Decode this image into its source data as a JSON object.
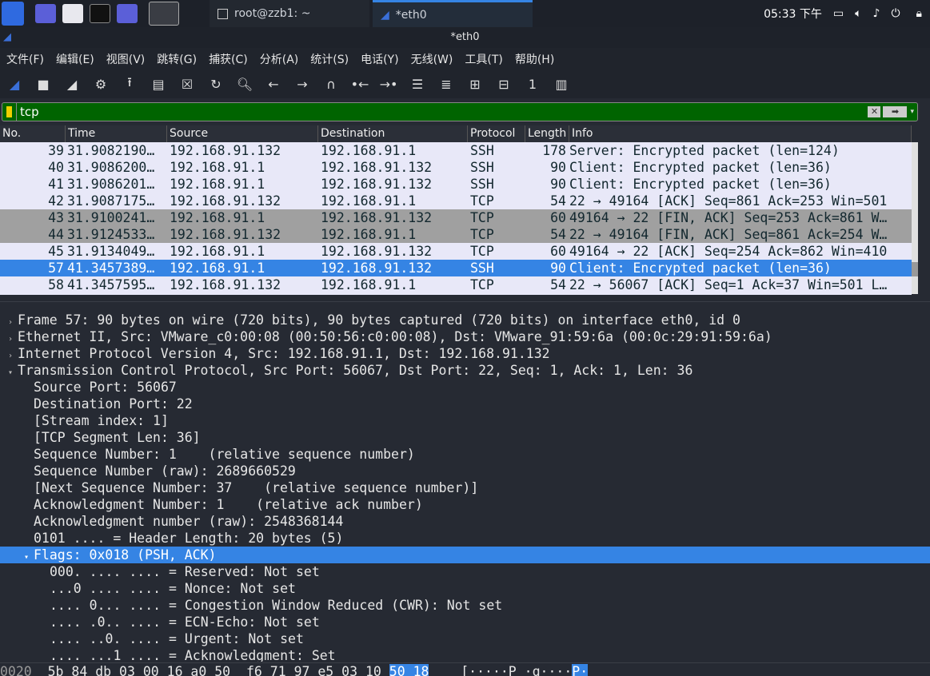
{
  "taskbar": {
    "tasks": [
      {
        "label": "root@zzb1: ~"
      },
      {
        "label": "*eth0"
      }
    ],
    "clock": "05:33 下午"
  },
  "window": {
    "title": "*eth0"
  },
  "menu": [
    "文件(F)",
    "编辑(E)",
    "视图(V)",
    "跳转(G)",
    "捕获(C)",
    "分析(A)",
    "统计(S)",
    "电话(Y)",
    "无线(W)",
    "工具(T)",
    "帮助(H)"
  ],
  "toolbar": [
    "start-capture-icon",
    "stop-capture-icon",
    "restart-capture-icon",
    "options-gear-icon",
    "open-file-icon",
    "save-file-icon",
    "close-file-icon",
    "reload-file-icon",
    "search-icon",
    "back-arrow-icon",
    "forward-arrow-icon",
    "goto-packet-icon",
    "first-packet-icon",
    "last-packet-icon",
    "autoscroll-icon",
    "colorize-icon",
    "zoom-in-icon",
    "zoom-out-icon",
    "normal-size-icon",
    "resize-columns-icon"
  ],
  "filter": {
    "value": "tcp"
  },
  "packet_list": {
    "columns": [
      "No.",
      "Time",
      "Source",
      "Destination",
      "Protocol",
      "Length",
      "Info"
    ],
    "rows": [
      {
        "no": "39",
        "time": "31.9082190…",
        "src": "192.168.91.132",
        "dst": "192.168.91.1",
        "proto": "SSH",
        "len": "178",
        "info": "Server: Encrypted packet (len=124)",
        "style": "normal"
      },
      {
        "no": "40",
        "time": "31.9086200…",
        "src": "192.168.91.1",
        "dst": "192.168.91.132",
        "proto": "SSH",
        "len": "90",
        "info": "Client: Encrypted packet (len=36)",
        "style": "normal"
      },
      {
        "no": "41",
        "time": "31.9086201…",
        "src": "192.168.91.1",
        "dst": "192.168.91.132",
        "proto": "SSH",
        "len": "90",
        "info": "Client: Encrypted packet (len=36)",
        "style": "normal"
      },
      {
        "no": "42",
        "time": "31.9087175…",
        "src": "192.168.91.132",
        "dst": "192.168.91.1",
        "proto": "TCP",
        "len": "54",
        "info": "22 → 49164 [ACK] Seq=861 Ack=253 Win=501",
        "style": "normal"
      },
      {
        "no": "43",
        "time": "31.9100241…",
        "src": "192.168.91.1",
        "dst": "192.168.91.132",
        "proto": "TCP",
        "len": "60",
        "info": "49164 → 22 [FIN, ACK] Seq=253 Ack=861 W…",
        "style": "fin"
      },
      {
        "no": "44",
        "time": "31.9124533…",
        "src": "192.168.91.132",
        "dst": "192.168.91.1",
        "proto": "TCP",
        "len": "54",
        "info": "22 → 49164 [FIN, ACK] Seq=861 Ack=254 W…",
        "style": "fin"
      },
      {
        "no": "45",
        "time": "31.9134049…",
        "src": "192.168.91.1",
        "dst": "192.168.91.132",
        "proto": "TCP",
        "len": "60",
        "info": "49164 → 22 [ACK] Seq=254 Ack=862 Win=410",
        "style": "normal"
      },
      {
        "no": "57",
        "time": "41.3457389…",
        "src": "192.168.91.1",
        "dst": "192.168.91.132",
        "proto": "SSH",
        "len": "90",
        "info": "Client: Encrypted packet (len=36)",
        "style": "sel"
      },
      {
        "no": "58",
        "time": "41.3457595…",
        "src": "192.168.91.132",
        "dst": "192.168.91.1",
        "proto": "TCP",
        "len": "54",
        "info": "22 → 56067 [ACK] Seq=1 Ack=37 Win=501 L…",
        "style": "normal"
      }
    ]
  },
  "details": [
    {
      "indent": 0,
      "arrow": "collapsed",
      "text": "Frame 57: 90 bytes on wire (720 bits), 90 bytes captured (720 bits) on interface eth0, id 0"
    },
    {
      "indent": 0,
      "arrow": "collapsed",
      "text": "Ethernet II, Src: VMware_c0:00:08 (00:50:56:c0:00:08), Dst: VMware_91:59:6a (00:0c:29:91:59:6a)"
    },
    {
      "indent": 0,
      "arrow": "collapsed",
      "text": "Internet Protocol Version 4, Src: 192.168.91.1, Dst: 192.168.91.132"
    },
    {
      "indent": 0,
      "arrow": "expanded",
      "text": "Transmission Control Protocol, Src Port: 56067, Dst Port: 22, Seq: 1, Ack: 1, Len: 36"
    },
    {
      "indent": 1,
      "arrow": "",
      "text": "Source Port: 56067"
    },
    {
      "indent": 1,
      "arrow": "",
      "text": "Destination Port: 22"
    },
    {
      "indent": 1,
      "arrow": "",
      "text": "[Stream index: 1]"
    },
    {
      "indent": 1,
      "arrow": "",
      "text": "[TCP Segment Len: 36]"
    },
    {
      "indent": 1,
      "arrow": "",
      "text": "Sequence Number: 1    (relative sequence number)"
    },
    {
      "indent": 1,
      "arrow": "",
      "text": "Sequence Number (raw): 2689660529"
    },
    {
      "indent": 1,
      "arrow": "",
      "text": "[Next Sequence Number: 37    (relative sequence number)]"
    },
    {
      "indent": 1,
      "arrow": "",
      "text": "Acknowledgment Number: 1    (relative ack number)"
    },
    {
      "indent": 1,
      "arrow": "",
      "text": "Acknowledgment number (raw): 2548368144"
    },
    {
      "indent": 1,
      "arrow": "",
      "text": "0101 .... = Header Length: 20 bytes (5)"
    },
    {
      "indent": 1,
      "arrow": "expanded",
      "text": "Flags: 0x018 (PSH, ACK)",
      "selected": true
    },
    {
      "indent": 2,
      "arrow": "",
      "text": "000. .... .... = Reserved: Not set"
    },
    {
      "indent": 2,
      "arrow": "",
      "text": "...0 .... .... = Nonce: Not set"
    },
    {
      "indent": 2,
      "arrow": "",
      "text": ".... 0... .... = Congestion Window Reduced (CWR): Not set"
    },
    {
      "indent": 2,
      "arrow": "",
      "text": ".... .0.. .... = ECN-Echo: Not set"
    },
    {
      "indent": 2,
      "arrow": "",
      "text": ".... ..0. .... = Urgent: Not set"
    },
    {
      "indent": 2,
      "arrow": "",
      "text": ".... ...1 .... = Acknowledgment: Set"
    }
  ],
  "hex": {
    "offset": "0020",
    "bytes_a": "5b 84 db 03 00 16 a0 50  f6 71 97 e5 03 10 ",
    "bytes_hl": "50 18",
    "ascii_a": "[·····P ·q····",
    "ascii_hl": "P·"
  }
}
